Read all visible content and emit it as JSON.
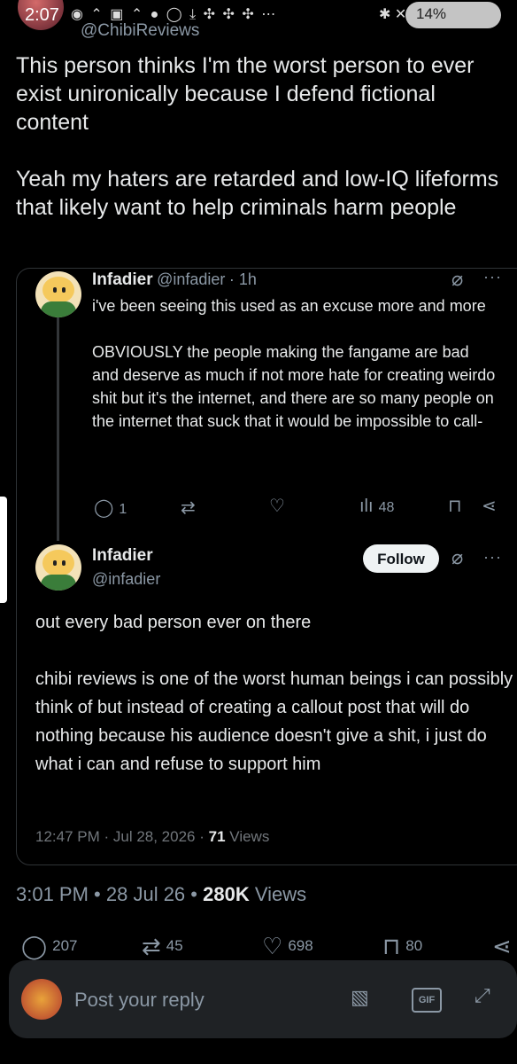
{
  "status_bar": {
    "time": "2:07",
    "battery": "14%"
  },
  "header": {
    "handle": "@ChibiReviews"
  },
  "tweet": {
    "text": "This person thinks I'm the worst person to ever exist unironically because I defend fictional content\n\nYeah my haters are retarded and low-IQ lifeforms that likely want to help criminals harm people",
    "time": "3:01 PM",
    "date": "28 Jul 26",
    "views_count": "280K",
    "views_label": "Views",
    "replies": "207",
    "reposts": "45",
    "likes": "698",
    "bookmarks": "80"
  },
  "quoted_1": {
    "name": "Infadier",
    "handle": "@infadier",
    "age": "· 1h",
    "text": "i've been seeing this used as an excuse more and more\n\nOBVIOUSLY the people making the fangame are bad and deserve as much if not more hate for creating weirdo shit but it's the internet, and there are so many people on the internet that suck that it would be impossible to call-",
    "replies": "1",
    "views": "48"
  },
  "quoted_2": {
    "name": "Infadier",
    "handle": "@infadier",
    "follow_label": "Follow",
    "text": "out every bad person ever on there\n\nchibi reviews is one of the worst human beings i can possibly think of but instead of creating a callout post that will do nothing because his audience doesn't give a shit, i just do what i can and refuse to support him",
    "timestamp": "12:47 PM · Jul 28, 2026 ·",
    "views_count": "71",
    "views_label": "Views"
  },
  "reply": {
    "placeholder": "Post your reply",
    "gif_label": "GIF"
  },
  "icons": {
    "reply": "speech-bubble-icon",
    "repost": "repost-icon",
    "like": "heart-icon",
    "bookmark": "bookmark-icon",
    "share": "share-icon",
    "views": "bar-chart-icon",
    "grok": "grok-icon",
    "more": "more-icon"
  }
}
